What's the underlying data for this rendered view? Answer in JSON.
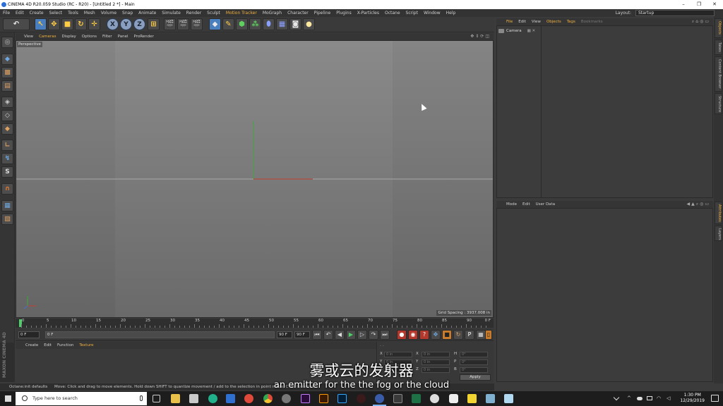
{
  "window": {
    "title": "CINEMA 4D R20.059 Studio (RC - R20) - [Untitled 2 *] - Main",
    "minimize": "–",
    "restore": "❐",
    "close": "✕"
  },
  "menubar": {
    "items": [
      "File",
      "Edit",
      "Create",
      "Select",
      "Tools",
      "Mesh",
      "Volume",
      "Snap",
      "Animate",
      "Simulate",
      "Render",
      "Sculpt",
      "Motion Tracker",
      "MoGraph",
      "Character",
      "Pipeline",
      "Plugins",
      "X-Particles",
      "Octane",
      "Script",
      "Window",
      "Help"
    ],
    "highlighted": [
      "Motion Tracker"
    ],
    "layout_label": "Layout:",
    "layout_value": "Startup"
  },
  "toolbar": {
    "axis_x": "X",
    "axis_y": "Y",
    "axis_z": "Z"
  },
  "viewport": {
    "menu": [
      "View",
      "Cameras",
      "Display",
      "Options",
      "Filter",
      "Panel",
      "ProRender"
    ],
    "highlighted": "Cameras",
    "label": "Perspective",
    "grid_spacing": "Grid Spacing : 3937.008 in"
  },
  "timeline": {
    "ticks": [
      "0",
      "5",
      "10",
      "15",
      "20",
      "25",
      "30",
      "35",
      "40",
      "45",
      "50",
      "55",
      "60",
      "65",
      "70",
      "75",
      "80",
      "85",
      "90"
    ],
    "end_label": "0 F"
  },
  "transport": {
    "current_frame": "0 F",
    "start_frame": "0 F",
    "end_frame": "90 F",
    "max_frame": "90 F"
  },
  "material_manager": {
    "menu": [
      "Create",
      "Edit",
      "Function",
      "Texture"
    ],
    "highlighted": "Texture",
    "logo_text": "MAXON CINEMA 4D"
  },
  "coordinates": {
    "rows": [
      {
        "axis": "X",
        "pos": "0 in",
        "sub": "X",
        "size": "0 in",
        "rot_axis": "H",
        "rot": "0°"
      },
      {
        "axis": "Y",
        "pos": "0 in",
        "sub": "Y",
        "size": "0 in",
        "rot_axis": "P",
        "rot": "0°"
      },
      {
        "axis": "Z",
        "pos": "0 in",
        "sub": "Z",
        "size": "0 in",
        "rot_axis": "B",
        "rot": "0°"
      }
    ],
    "apply_label": "Apply"
  },
  "statusbar": {
    "left": "Octane:init defaults",
    "message": "Move: Click and drag to move elements. Hold down SHIFT to quantize movement / add to the selection in point mode, CTRL to remove."
  },
  "object_manager": {
    "menu": [
      "File",
      "Edit",
      "View",
      "Objects",
      "Tags",
      "Bookmarks"
    ],
    "highlighted": [
      "File",
      "Objects",
      "Tags"
    ],
    "dimmed": [
      "Bookmarks"
    ],
    "objects": [
      {
        "name": "Camera"
      }
    ]
  },
  "attribute_manager": {
    "menu": [
      "Mode",
      "Edit",
      "User Data"
    ]
  },
  "side_tabs": {
    "top": [
      "Objects",
      "Takes",
      "Content Browser",
      "Structure"
    ],
    "bottom": [
      "Attributes",
      "Layers"
    ],
    "active": [
      "Objects",
      "Attributes"
    ]
  },
  "subtitles": {
    "chinese": "雾或云的发射器",
    "english": "an emitter for the the fog or the cloud"
  },
  "taskbar": {
    "search_placeholder": "Type here to search",
    "time": "1:30 PM",
    "date": "12/29/2019",
    "apps": [
      "task-view",
      "file-explorer",
      "store",
      "mail",
      "chrome",
      "app-a",
      "app-b",
      "premiere",
      "illustrator",
      "photoshop",
      "app-c",
      "cinema4d",
      "excel",
      "app-d",
      "app-e",
      "sticky-notes",
      "app-f"
    ]
  },
  "colors": {
    "accent_orange": "#f0b040",
    "x_axis": "#d04030",
    "y_axis": "#40b040",
    "timeline_cursor": "#4fcf6a"
  }
}
